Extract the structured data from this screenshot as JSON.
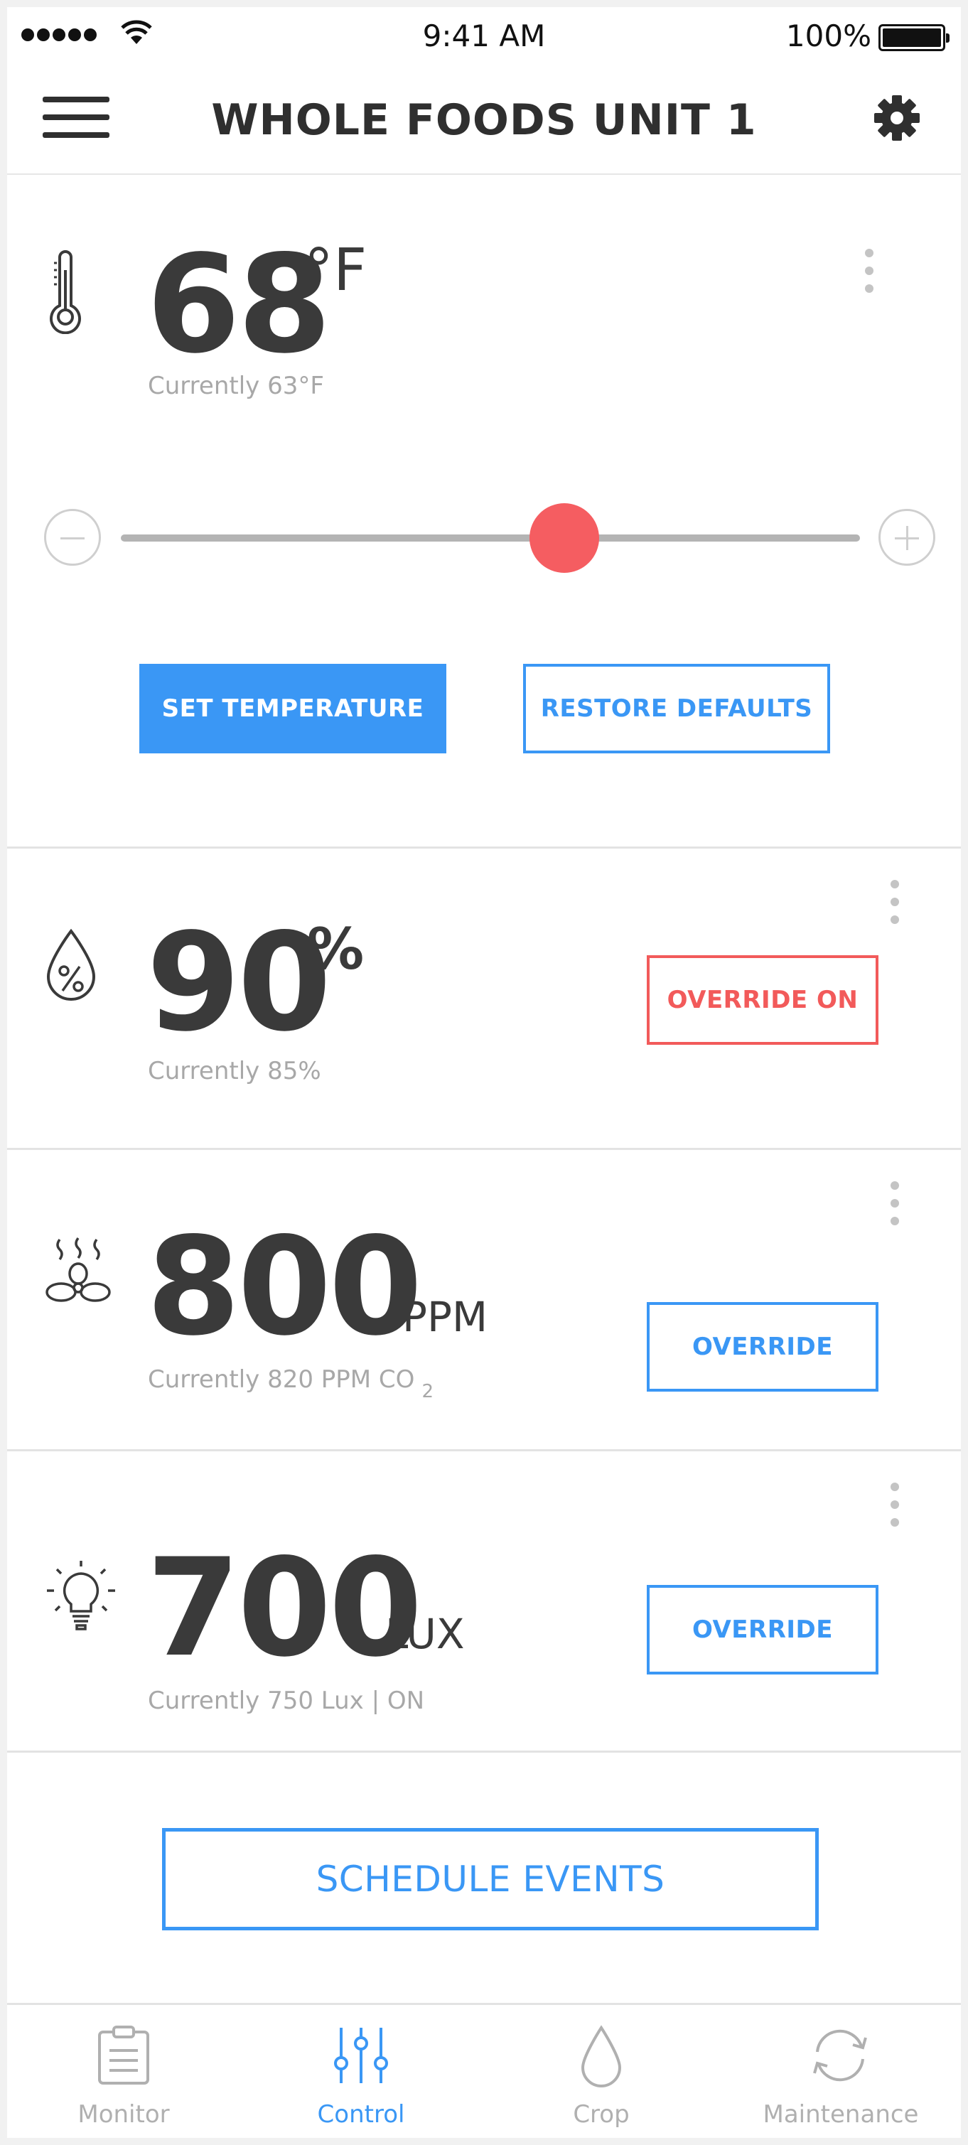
{
  "status_bar": {
    "time": "9:41 AM",
    "battery": "100%"
  },
  "header": {
    "title": "WHOLE FOODS UNIT 1"
  },
  "temperature": {
    "value": "68",
    "unit": "°F",
    "current": "Currently 63°F",
    "slider_level": 0.6,
    "set_label": "SET TEMPERATURE",
    "restore_label": "RESTORE DEFAULTS"
  },
  "humidity": {
    "value": "90",
    "unit": "%",
    "current": "Currently 85%",
    "button_label": "OVERRIDE ON"
  },
  "co2": {
    "value": "800",
    "unit": "PPM",
    "current": "Currently 820 PPM CO",
    "current_sub": "2",
    "button_label": "OVERRIDE"
  },
  "light": {
    "value": "700",
    "unit": "LUX",
    "current": "Currently 750 Lux | ON",
    "button_label": "OVERRIDE"
  },
  "schedule": {
    "label": "SCHEDULE EVENTS"
  },
  "tabs": [
    {
      "label": "Monitor",
      "icon": "clipboard-icon"
    },
    {
      "label": "Control",
      "icon": "sliders-icon",
      "active": true
    },
    {
      "label": "Crop",
      "icon": "drop-icon"
    },
    {
      "label": "Maintenance",
      "icon": "refresh-icon"
    }
  ],
  "colors": {
    "accent": "#3a97f5",
    "alert": "#f25a5a",
    "thumb": "#f55d61"
  }
}
